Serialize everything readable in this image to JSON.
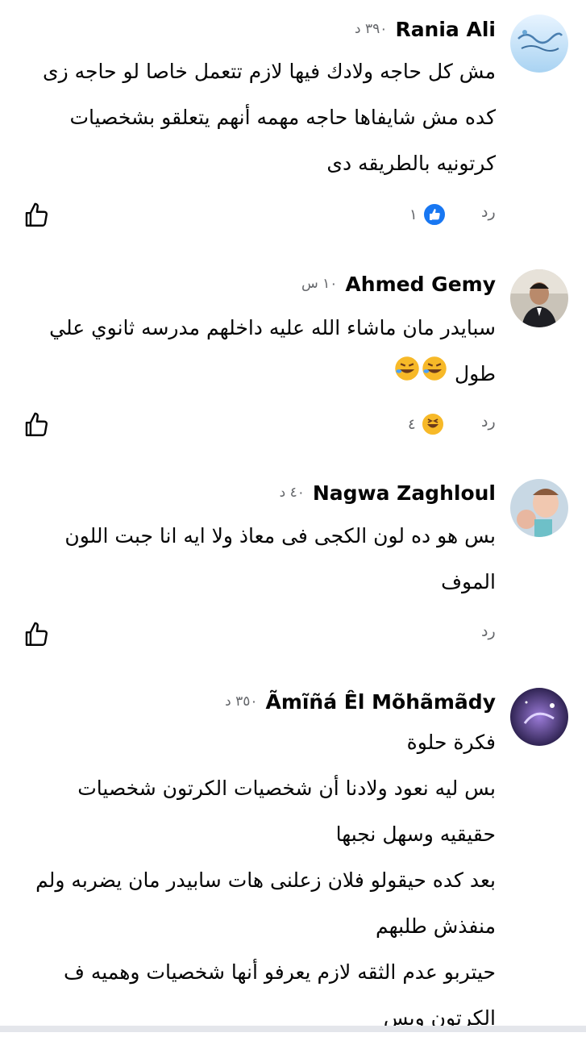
{
  "comments": [
    {
      "name": "Rania Ali",
      "time": "٣٩٠ د",
      "lines": [
        "مش كل حاجه ولادك فيها لازم تتعمل خاصا لو حاجه زى",
        "كده مش شايفاها حاجه مهمه أنهم يتعلقو بشخصيات",
        "كرتونيه بالطريقه دى"
      ],
      "reply": "رد",
      "reaction_icon": "like-reaction-icon",
      "reaction_count": "١"
    },
    {
      "name": "Ahmed Gemy",
      "time": "١٠ س",
      "lines": [
        "سبايدر مان ماشاء الله عليه داخلهم مدرسه ثانوي علي",
        "طول"
      ],
      "reply": "رد",
      "reaction_icon": "haha-reaction-icon",
      "reaction_count": "٤"
    },
    {
      "name": "Nagwa Zaghloul",
      "time": "٤٠ د",
      "lines": [
        "بس هو ده لون الكجى فى معاذ ولا ايه انا جبت اللون",
        "الموف"
      ],
      "reply": "رد"
    },
    {
      "name": "Ãmĩñá Êl Mõhãmãdy",
      "time": "٣٥٠ د",
      "lines": [
        "فكرة حلوة",
        "بس ليه نعود ولادنا أن شخصيات الكرتون شخصيات",
        "حقيقيه وسهل نجبها",
        "بعد كده حيقولو فلان زعلنى هات سابيدر مان يضربه ولم",
        "منفذش طلبهم",
        "حيتربو عدم الثقه لازم يعرفو أنها شخصيات وهميه ف",
        "الكرتون وبس"
      ]
    }
  ],
  "colors": {
    "like_blue": "#1877f2",
    "haha_yellow": "#f7b928",
    "secondary_text": "#65676b"
  }
}
